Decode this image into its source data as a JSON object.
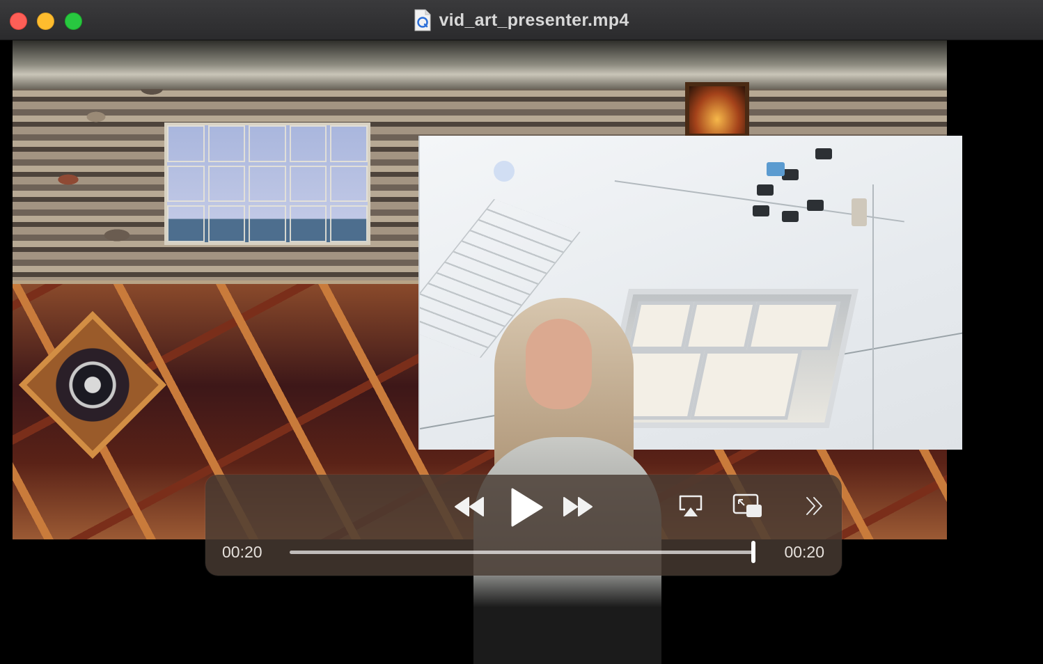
{
  "window": {
    "title": "vid_art_presenter.mp4",
    "file_icon": "quicktime-document-icon"
  },
  "player": {
    "current_time": "00:20",
    "total_time": "00:20",
    "progress": 1.0,
    "state": "paused",
    "buttons": {
      "rewind": "rewind-icon",
      "play": "play-icon",
      "fast_forward": "fast-forward-icon",
      "airplay": "airplay-icon",
      "pip": "picture-in-picture-icon",
      "more": "chevron-double-right-icon"
    }
  },
  "colors": {
    "close": "#fe5f57",
    "minimize": "#febc2e",
    "maximize": "#28c840",
    "controls_bg": "#483a32"
  }
}
